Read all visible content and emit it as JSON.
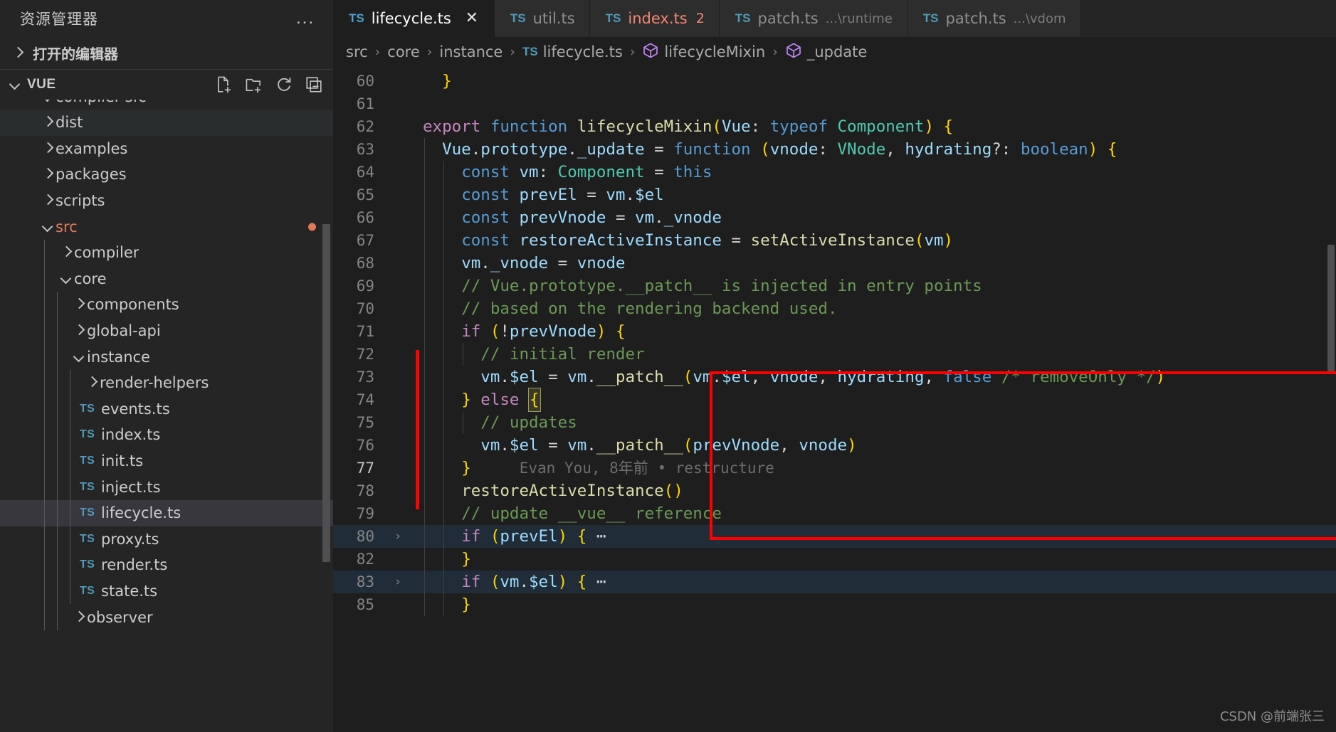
{
  "sidebar": {
    "title": "资源管理器",
    "more_label": "...",
    "open_editors_label": "打开的编辑器",
    "root_label": "VUE",
    "root_actions": [
      {
        "name": "new-file-icon",
        "label": "新建文件"
      },
      {
        "name": "new-folder-icon",
        "label": "新建文件夹"
      },
      {
        "name": "refresh-icon",
        "label": "刷新"
      },
      {
        "name": "collapse-all-icon",
        "label": "折叠文件夹"
      }
    ],
    "tree": [
      {
        "label": "compiler-sfc",
        "type": "folder",
        "expanded": true,
        "depth": 1,
        "clipped": true
      },
      {
        "label": "dist",
        "type": "folder",
        "expanded": false,
        "depth": 1,
        "hover": true
      },
      {
        "label": "examples",
        "type": "folder",
        "expanded": false,
        "depth": 1
      },
      {
        "label": "packages",
        "type": "folder",
        "expanded": false,
        "depth": 1
      },
      {
        "label": "scripts",
        "type": "folder",
        "expanded": false,
        "depth": 1
      },
      {
        "label": "src",
        "type": "folder",
        "expanded": true,
        "depth": 1,
        "modified": true,
        "dot": true
      },
      {
        "label": "compiler",
        "type": "folder",
        "expanded": false,
        "depth": 2
      },
      {
        "label": "core",
        "type": "folder",
        "expanded": true,
        "depth": 2
      },
      {
        "label": "components",
        "type": "folder",
        "expanded": false,
        "depth": 3
      },
      {
        "label": "global-api",
        "type": "folder",
        "expanded": false,
        "depth": 3
      },
      {
        "label": "instance",
        "type": "folder",
        "expanded": true,
        "depth": 3
      },
      {
        "label": "render-helpers",
        "type": "folder",
        "expanded": false,
        "depth": 4
      },
      {
        "label": "events.ts",
        "type": "file",
        "icon": "TS",
        "depth": 4
      },
      {
        "label": "index.ts",
        "type": "file",
        "icon": "TS",
        "depth": 4
      },
      {
        "label": "init.ts",
        "type": "file",
        "icon": "TS",
        "depth": 4
      },
      {
        "label": "inject.ts",
        "type": "file",
        "icon": "TS",
        "depth": 4
      },
      {
        "label": "lifecycle.ts",
        "type": "file",
        "icon": "TS",
        "depth": 4,
        "selected": true
      },
      {
        "label": "proxy.ts",
        "type": "file",
        "icon": "TS",
        "depth": 4
      },
      {
        "label": "render.ts",
        "type": "file",
        "icon": "TS",
        "depth": 4
      },
      {
        "label": "state.ts",
        "type": "file",
        "icon": "TS",
        "depth": 4
      },
      {
        "label": "observer",
        "type": "folder",
        "expanded": false,
        "depth": 3
      }
    ]
  },
  "tabs": [
    {
      "icon": "TS",
      "label": "lifecycle.ts",
      "active": true,
      "closable": true,
      "close_glyph": "✕"
    },
    {
      "icon": "TS",
      "label": "util.ts",
      "active": false
    },
    {
      "icon": "TS",
      "label": "index.ts",
      "active": false,
      "error": true,
      "badge": "2"
    },
    {
      "icon": "TS",
      "label": "patch.ts",
      "sub": "...\\runtime",
      "active": false
    },
    {
      "icon": "TS",
      "label": "patch.ts",
      "sub": "...\\vdom",
      "active": false
    }
  ],
  "breadcrumb": [
    {
      "label": "src",
      "icon": ""
    },
    {
      "label": "core",
      "icon": ""
    },
    {
      "label": "instance",
      "icon": ""
    },
    {
      "label": "lifecycle.ts",
      "icon": "TS"
    },
    {
      "label": "lifecycleMixin",
      "icon": "symbol-cube"
    },
    {
      "label": "_update",
      "icon": "symbol-cube"
    }
  ],
  "code": {
    "lines": [
      {
        "num": "60",
        "html": "  <span class='br1'>}</span>"
      },
      {
        "num": "61",
        "html": ""
      },
      {
        "num": "62",
        "html": "<span class='k'>export</span> <span class='kb'>function</span> <span class='fn'>lifecycleMixin</span><span class='br1'>(</span><span class='va'>Vue</span><span class='pn'>:</span> <span class='kb'>typeof</span> <span class='ty'>Component</span><span class='br1'>)</span> <span class='br1'>{</span>"
      },
      {
        "num": "63",
        "html": "  <span class='va'>Vue</span><span class='pn'>.</span><span class='va'>prototype</span><span class='pn'>.</span><span class='va'>_update</span> <span class='pn'>=</span> <span class='kb'>function</span> <span class='br1'>(</span><span class='va'>vnode</span><span class='pn'>:</span> <span class='ty'>VNode</span><span class='pn'>,</span> <span class='va'>hydrating</span><span class='pn'>?:</span> <span class='kb'>boolean</span><span class='br1'>)</span> <span class='br1'>{</span>"
      },
      {
        "num": "64",
        "html": "    <span class='kb'>const</span> <span class='va'>vm</span><span class='pn'>:</span> <span class='ty'>Component</span> <span class='pn'>=</span> <span class='kb'>this</span>"
      },
      {
        "num": "65",
        "html": "    <span class='kb'>const</span> <span class='va'>prevEl</span> <span class='pn'>=</span> <span class='va'>vm</span><span class='pn'>.</span><span class='va'>$el</span>"
      },
      {
        "num": "66",
        "html": "    <span class='kb'>const</span> <span class='va'>prevVnode</span> <span class='pn'>=</span> <span class='va'>vm</span><span class='pn'>.</span><span class='va'>_vnode</span>"
      },
      {
        "num": "67",
        "html": "    <span class='kb'>const</span> <span class='va'>restoreActiveInstance</span> <span class='pn'>=</span> <span class='fn'>setActiveInstance</span><span class='br1'>(</span><span class='va'>vm</span><span class='br1'>)</span>"
      },
      {
        "num": "68",
        "html": "    <span class='va'>vm</span><span class='pn'>.</span><span class='va'>_vnode</span> <span class='pn'>=</span> <span class='va'>vnode</span>"
      },
      {
        "num": "69",
        "html": "    <span class='cm'>// Vue.prototype.__patch__ is injected in entry points</span>"
      },
      {
        "num": "70",
        "html": "    <span class='cm'>// based on the rendering backend used.</span>"
      },
      {
        "num": "71",
        "html": "    <span class='k'>if</span> <span class='br1'>(</span><span class='pn'>!</span><span class='va'>prevVnode</span><span class='br1'>)</span> <span class='br1'>{</span>"
      },
      {
        "num": "72",
        "html": "      <span class='cm'>// initial render</span>"
      },
      {
        "num": "73",
        "html": "      <span class='va'>vm</span><span class='pn'>.</span><span class='va'>$el</span> <span class='pn'>=</span> <span class='va'>vm</span><span class='pn'>.</span><span class='fn'>__patch__</span><span class='br1'>(</span><span class='va'>vm</span><span class='pn'>.</span><span class='va'>$el</span><span class='pn'>,</span> <span class='va'>vnode</span><span class='pn'>,</span> <span class='va'>hydrating</span><span class='pn'>,</span> <span class='kb'>false</span> <span class='cm'>/* removeOnly */</span><span class='br1'>)</span>"
      },
      {
        "num": "74",
        "html": "    <span class='br1'>}</span> <span class='k'>else</span> <span class='cursor-box br1'>{</span>"
      },
      {
        "num": "75",
        "html": "      <span class='cm'>// updates</span>"
      },
      {
        "num": "76",
        "html": "      <span class='va'>vm</span><span class='pn'>.</span><span class='va'>$el</span> <span class='pn'>=</span> <span class='va'>vm</span><span class='pn'>.</span><span class='fn'>__patch__</span><span class='br1'>(</span><span class='va'>prevVnode</span><span class='pn'>,</span> <span class='va'>vnode</span><span class='br1'>)</span>"
      },
      {
        "num": "77",
        "html": "    <span class='br1'>}</span><span class='blame'>Evan You, 8年前 • restructure</span>",
        "current": true
      },
      {
        "num": "78",
        "html": "    <span class='fn'>restoreActiveInstance</span><span class='br1'>()</span>"
      },
      {
        "num": "79",
        "html": "    <span class='cm'>// update __vue__ reference</span>"
      },
      {
        "num": "80",
        "html": "    <span class='k'>if</span> <span class='br1'>(</span><span class='va'>prevEl</span><span class='br1'>)</span> <span class='br1'>{</span><span class='pn'> ⋯</span>",
        "folded": true,
        "fold_arrow": "›"
      },
      {
        "num": "82",
        "html": "    <span class='br1'>}</span>"
      },
      {
        "num": "83",
        "html": "    <span class='k'>if</span> <span class='br1'>(</span><span class='va'>vm</span><span class='pn'>.</span><span class='va'>$el</span><span class='br1'>)</span> <span class='br1'>{</span><span class='pn'> ⋯</span>",
        "folded": true,
        "fold_arrow": "›"
      },
      {
        "num": "85",
        "html": "    <span class='br1'>}</span>"
      }
    ],
    "blame_annotation": "Evan You, 8年前 • restructure",
    "highlight_box": {
      "start_line": "71",
      "end_line": "77",
      "color": "#ff0000"
    }
  },
  "watermark": "CSDN @前端张三",
  "colors": {
    "accent_error": "#f48771",
    "modified_file": "#e2795b",
    "ts_icon": "#519aba",
    "highlight_red": "#ff0000",
    "editor_bg": "#1e1e1e",
    "sidebar_bg": "#252526"
  }
}
